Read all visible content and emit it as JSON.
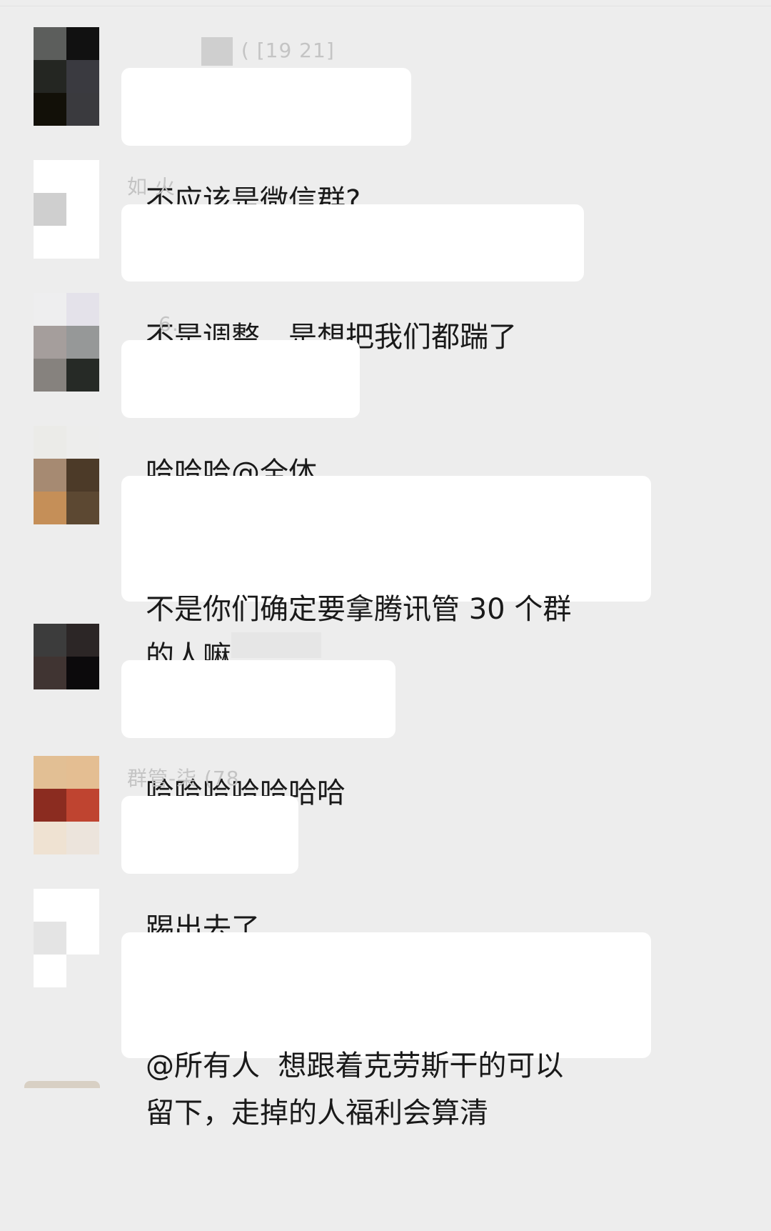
{
  "chat": {
    "messages": [
      {
        "sender_name": "(  [19  21]",
        "text": "不应该是微信群?",
        "avatar_colors": [
          "#5c5e5c",
          "#111111",
          "#242622",
          "#3a3a40",
          "#121008",
          "#3a3a3e"
        ]
      },
      {
        "sender_name": "如   火",
        "text": "不是调整，是想把我们都踹了",
        "avatar_colors": [
          "#ffffff",
          "#ffffff",
          "#cfcfcf",
          "#ffffff",
          "#ffffff",
          "#ffffff"
        ]
      },
      {
        "sender_name": "6.",
        "text": "哈哈哈@全体",
        "avatar_colors": [
          "#eeeeef",
          "#e4e2ea",
          "#a59e9c",
          "#969898",
          "#86827e",
          "#262a26"
        ]
      },
      {
        "sender_name": "",
        "text": "不是你们确定要拿腾讯管 30 个群\n的人嘛",
        "avatar_colors": [
          "#ebebe8",
          "#ededec",
          "#a68a72",
          "#4c3a28",
          "#c58f58",
          "#5c4832"
        ]
      },
      {
        "sender_name": "",
        "text": "哈哈哈哈哈哈哈",
        "avatar_colors": [
          "#3c3c3c",
          "#2c2626",
          "#403432",
          "#0c0a0c",
          "#ededed",
          "#ededed"
        ]
      },
      {
        "sender_name": "群管-柒   (78",
        "text": "踢出去了",
        "avatar_colors": [
          "#e2bf94",
          "#e4be92",
          "#8b2c20",
          "#bf4430",
          "#efe2d2",
          "#ece4dc"
        ]
      },
      {
        "sender_name": "",
        "text": "@所有人  想跟着克劳斯干的可以\n留下，走掉的人福利会算清",
        "avatar_colors": [
          "#ffffff",
          "#ffffff",
          "#e4e4e4",
          "#ffffff",
          "#ffffff",
          "#ededed"
        ]
      }
    ]
  }
}
